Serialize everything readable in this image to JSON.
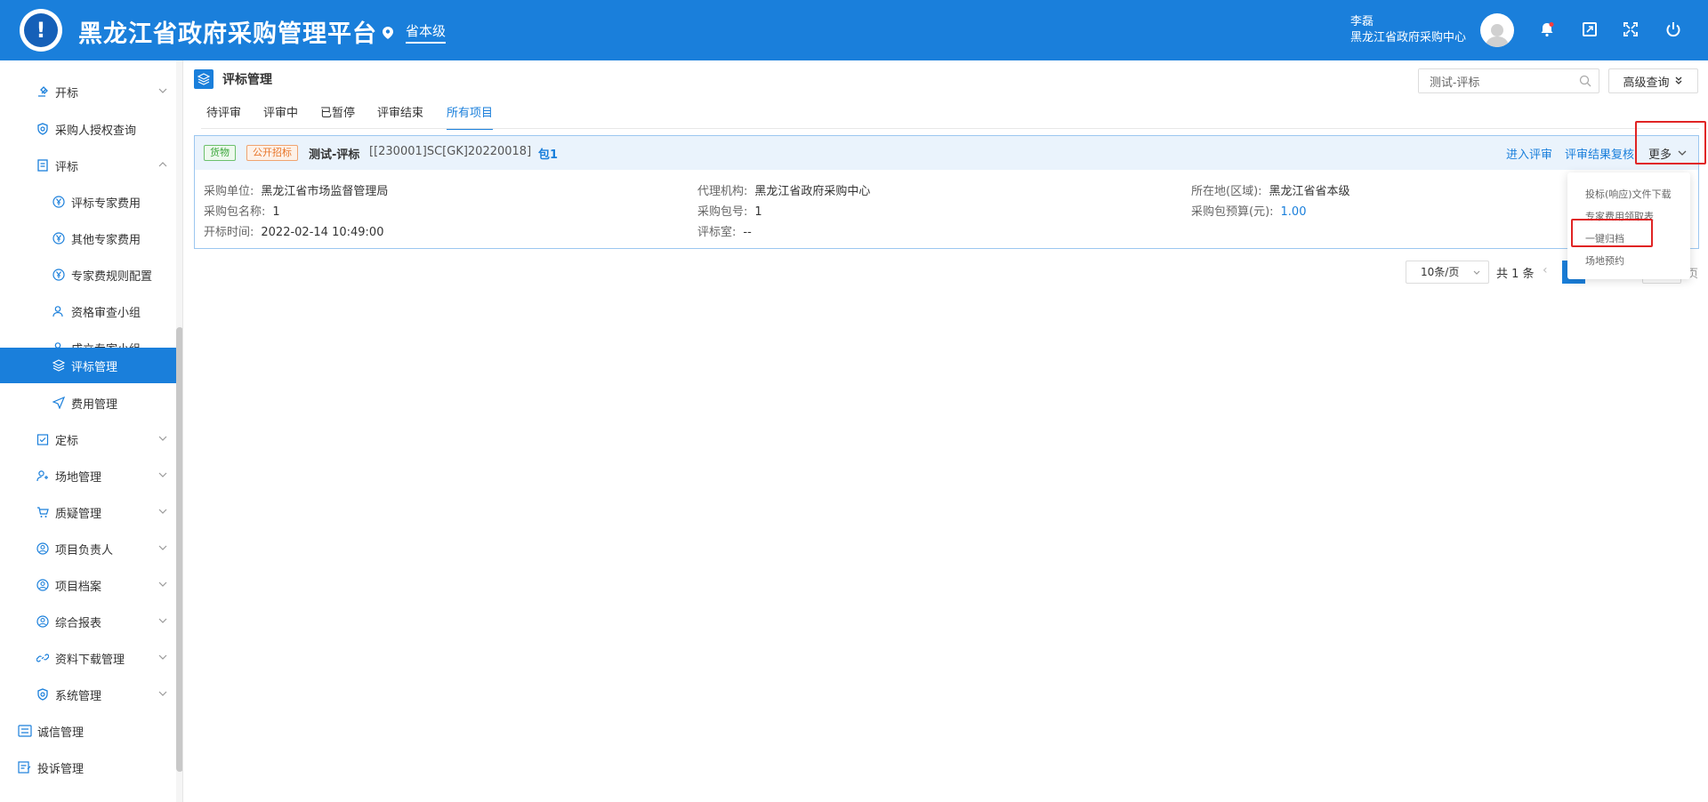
{
  "header": {
    "app_title": "黑龙江省政府采购管理平台",
    "region_label": "省本级",
    "user_name": "李磊",
    "user_org": "黑龙江省政府采购中心",
    "logo_glyph": "!"
  },
  "sidebar": {
    "items": [
      {
        "label": "开标",
        "icon": "gavel-icon"
      },
      {
        "label": "采购人授权查询",
        "icon": "shield-check-icon"
      },
      {
        "label": "评标",
        "icon": "doc-review-icon"
      },
      {
        "label": "评标专家费用",
        "icon": "yen-icon"
      },
      {
        "label": "其他专家费用",
        "icon": "yen-icon"
      },
      {
        "label": "专家费规则配置",
        "icon": "yen-icon"
      },
      {
        "label": "资格审查小组",
        "icon": "user-group-icon"
      },
      {
        "label": "成立专家小组",
        "icon": "user-group-icon"
      },
      {
        "label": "评标管理",
        "icon": "layers-icon"
      },
      {
        "label": "费用管理",
        "icon": "send-icon"
      },
      {
        "label": "定标",
        "icon": "calendar-check-icon"
      },
      {
        "label": "场地管理",
        "icon": "user-venue-icon"
      },
      {
        "label": "质疑管理",
        "icon": "cart-icon"
      },
      {
        "label": "项目负责人",
        "icon": "user-circle-icon"
      },
      {
        "label": "项目档案",
        "icon": "user-circle-icon"
      },
      {
        "label": "综合报表",
        "icon": "user-circle-icon"
      },
      {
        "label": "资料下载管理",
        "icon": "link-icon"
      },
      {
        "label": "系统管理",
        "icon": "shield-icon"
      },
      {
        "label": "诚信管理",
        "icon": "list-icon"
      },
      {
        "label": "投诉管理",
        "icon": "form-icon"
      }
    ]
  },
  "main": {
    "page_title": "评标管理",
    "search": {
      "value": "测试-评标"
    },
    "advanced_query_label": "高级查询",
    "tabs": [
      {
        "label": "待评审"
      },
      {
        "label": "评审中"
      },
      {
        "label": "已暂停"
      },
      {
        "label": "评审结束"
      },
      {
        "label": "所有项目"
      }
    ],
    "active_tab": "所有项目",
    "project": {
      "tag_goods": "货物",
      "tag_method": "公开招标",
      "name": "测试-评标",
      "code": "[[230001]SC[GK]20220018]",
      "package": "包1",
      "action_enter": "进入评审",
      "action_recheck": "评审结果复核",
      "action_more": "更多",
      "fields": {
        "purchaser_label": "采购单位:",
        "purchaser_value": "黑龙江省市场监督管理局",
        "agency_label": "代理机构:",
        "agency_value": "黑龙江省政府采购中心",
        "location_label": "所在地(区域):",
        "location_value": "黑龙江省省本级",
        "pkg_name_label": "采购包名称:",
        "pkg_name_value": "1",
        "pkg_no_label": "采购包号:",
        "pkg_no_value": "1",
        "budget_label": "采购包预算(元):",
        "budget_value": "1.00",
        "open_time_label": "开标时间:",
        "open_time_value": "2022-02-14 10:49:00",
        "room_label": "评标室:",
        "room_value": "--"
      }
    },
    "pagination": {
      "page_size": "10条/页",
      "total": "共 1 条",
      "current_page": "1",
      "suffix": "页"
    },
    "more_menu": [
      {
        "label": "投标(响应)文件下载"
      },
      {
        "label": "专家费用领取表"
      },
      {
        "label": "一键归档"
      },
      {
        "label": "场地预约"
      }
    ]
  },
  "colors": {
    "primary": "#1a7fdb",
    "highlight": "#e02424",
    "tag_goods": "#3aa63a",
    "tag_method": "#e8762a"
  }
}
